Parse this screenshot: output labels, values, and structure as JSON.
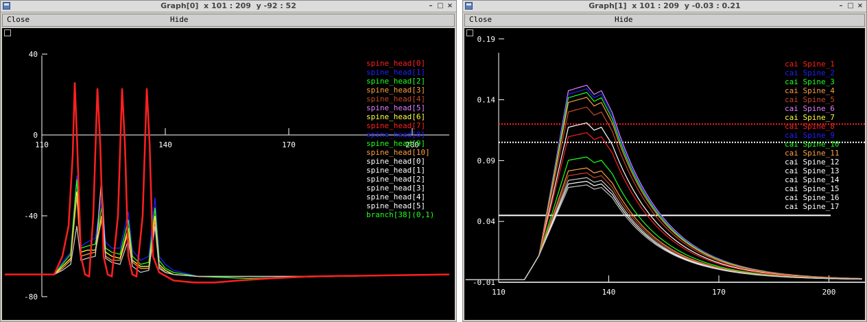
{
  "colors": {
    "red": "#ff2020",
    "blue": "#2020ff",
    "green": "#20ff20",
    "orange": "#ffa040",
    "brown": "#c84828",
    "violet": "#e080ff",
    "yellow": "#ffff40",
    "white": "#ffffff",
    "gray": "#c8c8c8"
  },
  "left_window": {
    "title": "Graph[0]  x 101 : 209  y -92 : 52",
    "menu": {
      "close": "Close",
      "hide": "Hide"
    },
    "window_buttons": [
      "–",
      "□",
      "×"
    ],
    "chart_data": {
      "type": "line",
      "x_ticks": [
        "110",
        "140",
        "170",
        "200"
      ],
      "y_ticks": [
        "40",
        "0",
        "-40",
        "-80"
      ],
      "xlim": [
        101,
        209
      ],
      "ylim": [
        -92,
        52
      ],
      "legend": [
        {
          "label": "spine_head[0]",
          "color": "red"
        },
        {
          "label": "spine_head[1]",
          "color": "blue"
        },
        {
          "label": "spine_head[2]",
          "color": "green"
        },
        {
          "label": "spine_head[3]",
          "color": "orange"
        },
        {
          "label": "spine_head[4]",
          "color": "brown"
        },
        {
          "label": "spine_head[5]",
          "color": "violet"
        },
        {
          "label": "spine_head[6]",
          "color": "yellow"
        },
        {
          "label": "spine_head[7]",
          "color": "red"
        },
        {
          "label": "spine_head[8]",
          "color": "blue"
        },
        {
          "label": "spine_head[9]",
          "color": "green"
        },
        {
          "label": "spine_head[10]",
          "color": "orange"
        },
        {
          "label": "spine_head[0]",
          "color": "white"
        },
        {
          "label": "spine_head[1]",
          "color": "white"
        },
        {
          "label": "spine_head[2]",
          "color": "white"
        },
        {
          "label": "spine_head[3]",
          "color": "white"
        },
        {
          "label": "spine_head[4]",
          "color": "white"
        },
        {
          "label": "spine_head[5]",
          "color": "white"
        },
        {
          "label": "branch[38](0,1)",
          "color": "green"
        }
      ],
      "series": [
        {
          "color": "blue",
          "points": [
            [
              101,
              -69
            ],
            [
              113,
              -69
            ],
            [
              115,
              -63
            ],
            [
              117,
              -58
            ],
            [
              118.5,
              -20
            ],
            [
              119.5,
              -55
            ],
            [
              121,
              -53
            ],
            [
              123,
              -51
            ],
            [
              124.5,
              -31
            ],
            [
              125.5,
              -53
            ],
            [
              127,
              -56
            ],
            [
              129,
              -56
            ],
            [
              131,
              -38
            ],
            [
              132,
              -57
            ],
            [
              134,
              -62
            ],
            [
              136,
              -60
            ],
            [
              137.5,
              -31
            ],
            [
              138.5,
              -60
            ],
            [
              140,
              -64
            ],
            [
              142,
              -67
            ],
            [
              148,
              -70
            ],
            [
              160,
              -70
            ],
            [
              180,
              -70
            ],
            [
              209,
              -69
            ]
          ]
        },
        {
          "color": "green",
          "points": [
            [
              101,
              -69
            ],
            [
              113,
              -69
            ],
            [
              115,
              -64
            ],
            [
              117,
              -59
            ],
            [
              118.5,
              -22
            ],
            [
              119.5,
              -56
            ],
            [
              121,
              -55
            ],
            [
              123,
              -54
            ],
            [
              124.5,
              -36
            ],
            [
              125.5,
              -56
            ],
            [
              127,
              -58
            ],
            [
              129,
              -59
            ],
            [
              131,
              -42
            ],
            [
              132,
              -60
            ],
            [
              134,
              -64
            ],
            [
              136,
              -63
            ],
            [
              137.5,
              -36
            ],
            [
              138.5,
              -62
            ],
            [
              140,
              -66
            ],
            [
              142,
              -68
            ],
            [
              148,
              -70
            ],
            [
              160,
              -71
            ],
            [
              180,
              -70
            ],
            [
              209,
              -69
            ]
          ]
        },
        {
          "color": "yellow",
          "points": [
            [
              101,
              -69
            ],
            [
              113,
              -69
            ],
            [
              115,
              -65
            ],
            [
              117,
              -61
            ],
            [
              118.5,
              -28
            ],
            [
              119.5,
              -58
            ],
            [
              121,
              -57
            ],
            [
              123,
              -57
            ],
            [
              124.5,
              -40
            ],
            [
              125.5,
              -58
            ],
            [
              127,
              -60
            ],
            [
              129,
              -61
            ],
            [
              131,
              -46
            ],
            [
              132,
              -62
            ],
            [
              134,
              -65
            ],
            [
              136,
              -65
            ],
            [
              137.5,
              -40
            ],
            [
              138.5,
              -64
            ],
            [
              140,
              -67
            ],
            [
              142,
              -69
            ],
            [
              148,
              -70
            ],
            [
              160,
              -70
            ],
            [
              180,
              -70
            ],
            [
              209,
              -69
            ]
          ]
        },
        {
          "color": "orange",
          "points": [
            [
              101,
              -69
            ],
            [
              113,
              -69
            ],
            [
              115,
              -66
            ],
            [
              117,
              -62
            ],
            [
              118.5,
              -30
            ],
            [
              119.5,
              -60
            ],
            [
              121,
              -59
            ],
            [
              123,
              -58
            ],
            [
              124.5,
              -42
            ],
            [
              125.5,
              -60
            ],
            [
              127,
              -62
            ],
            [
              129,
              -62
            ],
            [
              131,
              -48
            ],
            [
              132,
              -63
            ],
            [
              134,
              -66
            ],
            [
              136,
              -66
            ],
            [
              137.5,
              -42
            ],
            [
              138.5,
              -65
            ],
            [
              140,
              -68
            ],
            [
              142,
              -69
            ],
            [
              148,
              -70
            ],
            [
              160,
              -70
            ],
            [
              180,
              -70
            ],
            [
              209,
              -69
            ]
          ]
        },
        {
          "color": "gray",
          "points": [
            [
              101,
              -69
            ],
            [
              113,
              -69
            ],
            [
              115,
              -67
            ],
            [
              117,
              -64
            ],
            [
              118.5,
              -45
            ],
            [
              119.5,
              -62
            ],
            [
              121,
              -61
            ],
            [
              123,
              -60
            ],
            [
              124.5,
              -22
            ],
            [
              125.5,
              -61
            ],
            [
              127,
              -63
            ],
            [
              129,
              -64
            ],
            [
              131,
              -52
            ],
            [
              132,
              -65
            ],
            [
              134,
              -68
            ],
            [
              136,
              -67
            ],
            [
              137.5,
              -45
            ],
            [
              138.5,
              -66
            ],
            [
              140,
              -68
            ],
            [
              142,
              -69
            ],
            [
              148,
              -70
            ],
            [
              160,
              -70
            ],
            [
              180,
              -70
            ],
            [
              209,
              -69
            ]
          ]
        },
        {
          "color": "red",
          "points": [
            [
              101,
              -69
            ],
            [
              113,
              -69
            ],
            [
              115,
              -60
            ],
            [
              116.5,
              -45
            ],
            [
              117.5,
              -10
            ],
            [
              118,
              26
            ],
            [
              118.6,
              -5
            ],
            [
              119.5,
              -60
            ],
            [
              120.5,
              -69
            ],
            [
              121.5,
              -70
            ],
            [
              122.5,
              -40
            ],
            [
              123.5,
              23
            ],
            [
              124.2,
              -5
            ],
            [
              125,
              -60
            ],
            [
              126,
              -69
            ],
            [
              127,
              -70
            ],
            [
              128.5,
              -40
            ],
            [
              129.5,
              23
            ],
            [
              130.2,
              -5
            ],
            [
              131,
              -60
            ],
            [
              132,
              -69
            ],
            [
              133,
              -70
            ],
            [
              134.5,
              -40
            ],
            [
              135.5,
              23
            ],
            [
              136.2,
              -5
            ],
            [
              137,
              -60
            ],
            [
              138.5,
              -68
            ],
            [
              142,
              -72
            ],
            [
              147,
              -73
            ],
            [
              152,
              -73
            ],
            [
              158,
              -72
            ],
            [
              165,
              -71
            ],
            [
              175,
              -70
            ],
            [
              209,
              -69
            ]
          ]
        }
      ]
    }
  },
  "right_window": {
    "title": "Graph[1]  x 101 : 209  y -0.03 : 0.21",
    "menu": {
      "close": "Close",
      "hide": "Hide"
    },
    "window_buttons": [
      "–",
      "□",
      "×"
    ],
    "chart_data": {
      "type": "line",
      "x_ticks": [
        "110",
        "140",
        "170",
        "200"
      ],
      "y_ticks": [
        "0.19",
        "0.14",
        "0.09",
        "0.04",
        "-0.01"
      ],
      "xlim": [
        101,
        209
      ],
      "ylim": [
        -0.03,
        0.21
      ],
      "hlines": [
        {
          "y": 0.12,
          "color": "red",
          "dotted": true
        },
        {
          "y": 0.105,
          "color": "white",
          "dotted": true
        },
        {
          "y": 0.045,
          "color": "white",
          "dotted": false
        }
      ],
      "legend": [
        {
          "label": "cai Spine_1",
          "color": "red"
        },
        {
          "label": "cai Spine_2",
          "color": "blue"
        },
        {
          "label": "cai Spine_3",
          "color": "green"
        },
        {
          "label": "cai Spine_4",
          "color": "orange"
        },
        {
          "label": "cai Spine_5",
          "color": "brown"
        },
        {
          "label": "cai Spine_6",
          "color": "violet"
        },
        {
          "label": "cai Spine_7",
          "color": "yellow"
        },
        {
          "label": "cai Spine_8",
          "color": "red"
        },
        {
          "label": "cai Spine_9",
          "color": "blue"
        },
        {
          "label": "cai Spine_10",
          "color": "green"
        },
        {
          "label": "cai Spine_11",
          "color": "orange"
        },
        {
          "label": "cai Spine_12",
          "color": "white"
        },
        {
          "label": "cai Spine_13",
          "color": "white"
        },
        {
          "label": "cai Spine_14",
          "color": "white"
        },
        {
          "label": "cai Spine_15",
          "color": "white"
        },
        {
          "label": "cai Spine_16",
          "color": "white"
        },
        {
          "label": "cai Spine_17",
          "color": "white"
        }
      ],
      "series": [
        {
          "color": "violet",
          "peak": 0.152
        },
        {
          "color": "blue",
          "peak": 0.149
        },
        {
          "color": "green",
          "peak": 0.146
        },
        {
          "color": "orange",
          "peak": 0.142
        },
        {
          "color": "brown",
          "peak": 0.134
        },
        {
          "color": "white",
          "peak": 0.121
        },
        {
          "color": "red",
          "peak": 0.113
        },
        {
          "color": "green",
          "peak": 0.093
        },
        {
          "color": "orange",
          "peak": 0.084
        },
        {
          "color": "brown",
          "peak": 0.08
        },
        {
          "color": "gray",
          "peak": 0.076
        },
        {
          "color": "white",
          "peak": 0.073
        },
        {
          "color": "gray",
          "peak": 0.07
        }
      ]
    }
  }
}
